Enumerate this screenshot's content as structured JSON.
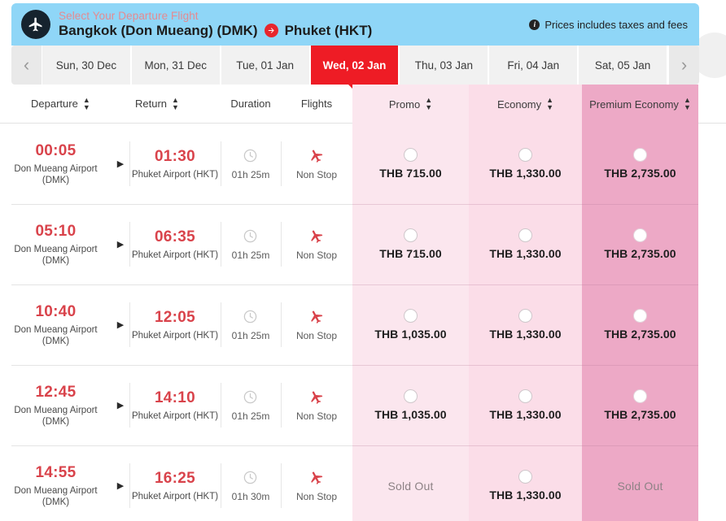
{
  "header": {
    "subtitle": "Select Your Departure Flight",
    "origin": "Bangkok (Don Mueang) (DMK)",
    "destination": "Phuket (HKT)",
    "note": "Prices includes taxes and fees",
    "info_icon": "info-icon",
    "plane_icon": "plane-icon",
    "arrow_icon": "arrow-right-icon",
    "bg_color": "#8fd6f7",
    "accent_color": "#e8262d"
  },
  "date_tabs": {
    "prev_icon": "chevron-left-icon",
    "next_icon": "chevron-right-icon",
    "active_index": 3,
    "items": [
      {
        "label": "Sun, 30 Dec"
      },
      {
        "label": "Mon, 31 Dec"
      },
      {
        "label": "Tue, 01 Jan"
      },
      {
        "label": "Wed, 02 Jan"
      },
      {
        "label": "Thu, 03 Jan"
      },
      {
        "label": "Fri, 04 Jan"
      },
      {
        "label": "Sat, 05 Jan"
      }
    ]
  },
  "table": {
    "columns": [
      {
        "label": "Departure",
        "sortable": true
      },
      {
        "label": "Return",
        "sortable": true
      },
      {
        "label": "Duration",
        "sortable": false
      },
      {
        "label": "Flights",
        "sortable": false
      },
      {
        "label": "Promo",
        "sortable": true
      },
      {
        "label": "Economy",
        "sortable": true
      },
      {
        "label": "Premium Economy",
        "sortable": true
      }
    ],
    "fare_colors": {
      "promo": "#fbe6ee",
      "economy": "#fbdde8",
      "premium_economy": "#eda9c6"
    },
    "rows": [
      {
        "depart_time": "00:05",
        "depart_airport": "Don Mueang Airport (DMK)",
        "arrive_time": "01:30",
        "arrive_airport": "Phuket Airport (HKT)",
        "duration": "01h 25m",
        "flights": "Non Stop",
        "promo": "THB 715.00",
        "promo_available": true,
        "economy": "THB 1,330.00",
        "economy_available": true,
        "premium": "THB 2,735.00",
        "premium_available": true
      },
      {
        "depart_time": "05:10",
        "depart_airport": "Don Mueang Airport (DMK)",
        "arrive_time": "06:35",
        "arrive_airport": "Phuket Airport (HKT)",
        "duration": "01h 25m",
        "flights": "Non Stop",
        "promo": "THB 715.00",
        "promo_available": true,
        "economy": "THB 1,330.00",
        "economy_available": true,
        "premium": "THB 2,735.00",
        "premium_available": true
      },
      {
        "depart_time": "10:40",
        "depart_airport": "Don Mueang Airport (DMK)",
        "arrive_time": "12:05",
        "arrive_airport": "Phuket Airport (HKT)",
        "duration": "01h 25m",
        "flights": "Non Stop",
        "promo": "THB 1,035.00",
        "promo_available": true,
        "economy": "THB 1,330.00",
        "economy_available": true,
        "premium": "THB 2,735.00",
        "premium_available": true
      },
      {
        "depart_time": "12:45",
        "depart_airport": "Don Mueang Airport (DMK)",
        "arrive_time": "14:10",
        "arrive_airport": "Phuket Airport (HKT)",
        "duration": "01h 25m",
        "flights": "Non Stop",
        "promo": "THB 1,035.00",
        "promo_available": true,
        "economy": "THB 1,330.00",
        "economy_available": true,
        "premium": "THB 2,735.00",
        "premium_available": true
      },
      {
        "depart_time": "14:55",
        "depart_airport": "Don Mueang Airport (DMK)",
        "arrive_time": "16:25",
        "arrive_airport": "Phuket Airport (HKT)",
        "duration": "01h 30m",
        "flights": "Non Stop",
        "promo": "Sold Out",
        "promo_available": false,
        "economy": "THB 1,330.00",
        "economy_available": true,
        "premium": "Sold Out",
        "premium_available": false
      }
    ]
  }
}
